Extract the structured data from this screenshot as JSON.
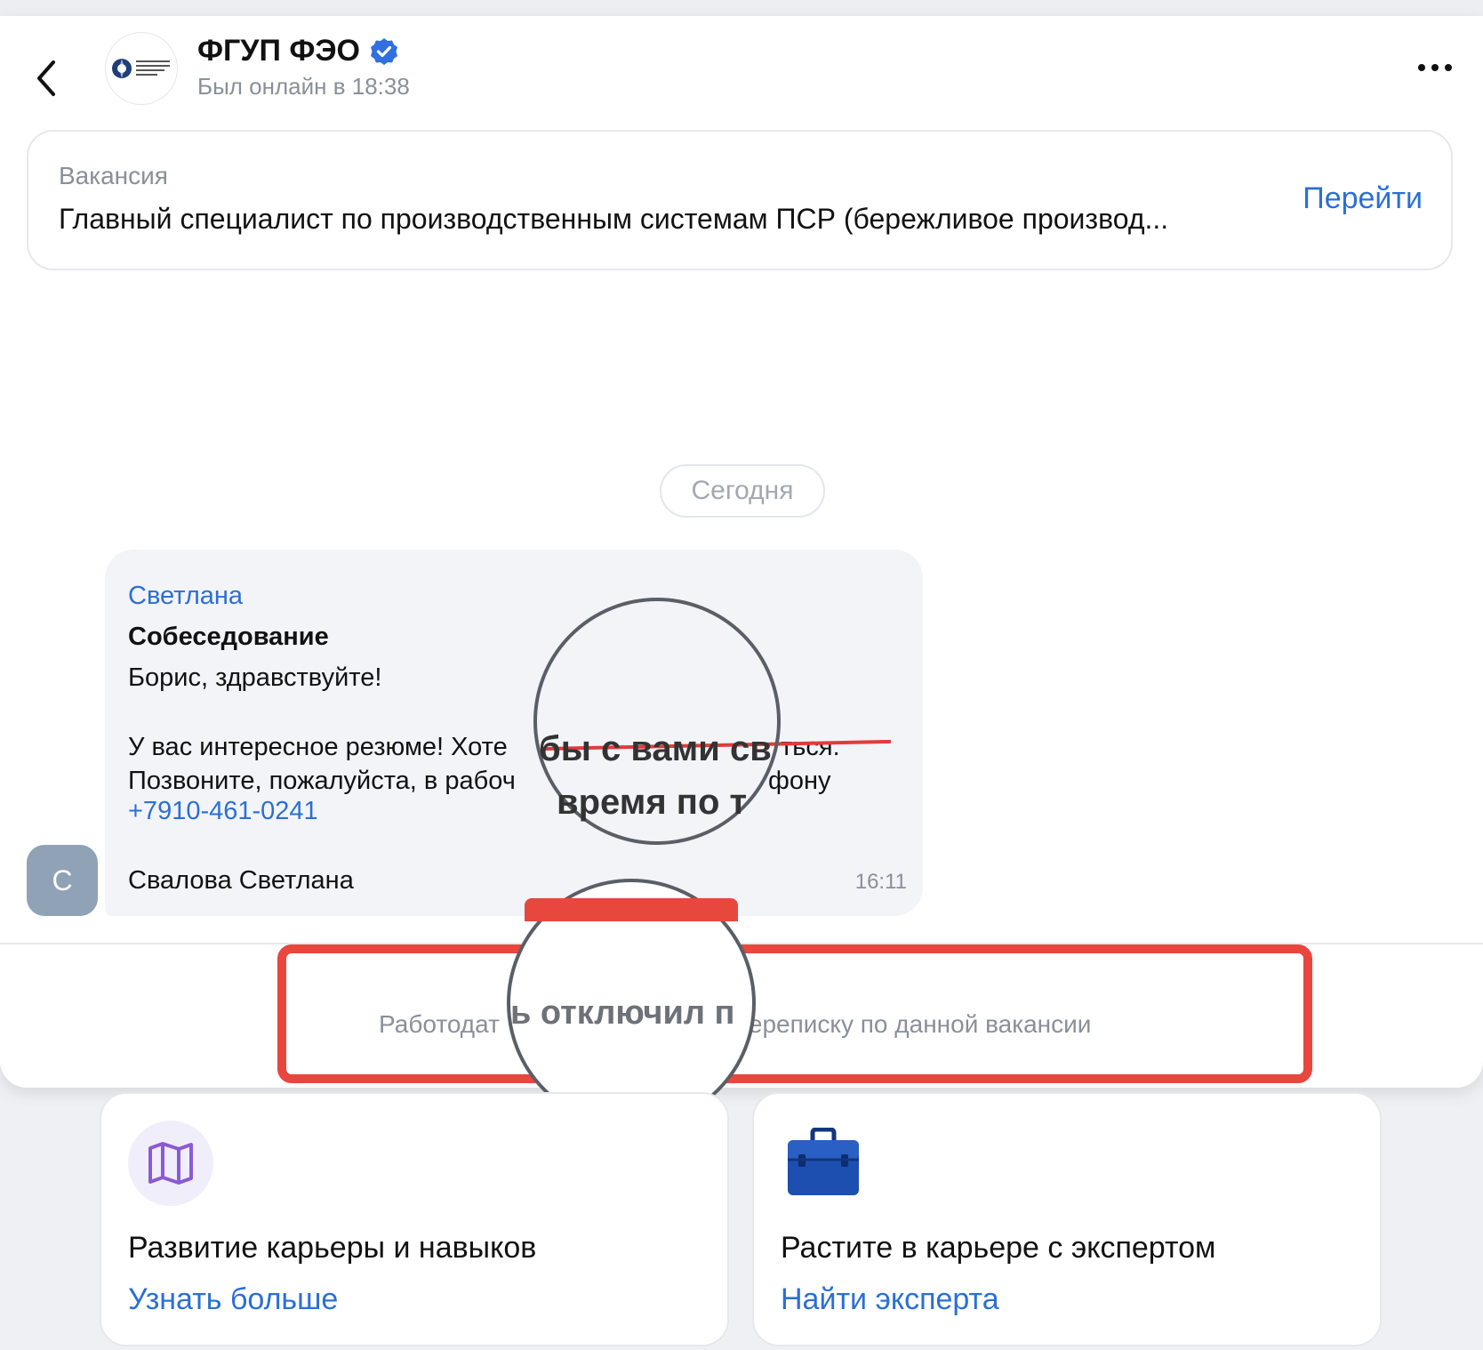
{
  "header": {
    "company_name": "ФГУП ФЭО",
    "status": "Был онлайн в 18:38"
  },
  "vacancy": {
    "label": "Вакансия",
    "title": "Главный специалист по производственным системам ПСР (бережливое производ...",
    "go_label": "Перейти"
  },
  "chat": {
    "date_label": "Сегодня",
    "message": {
      "sender": "Светлана",
      "subject": "Собеседование",
      "greeting": "Борис, здравствуйте!",
      "line1": "У вас интересное резюме! Хоте",
      "line1_end": "ться.",
      "line2": "Позвоните, пожалуйста, в рабоч",
      "line2_end": "фону",
      "phone": "+7910-461-0241",
      "signature": "Свалова Светлана",
      "time": "16:11"
    },
    "avatar_letter": "С",
    "magnifier1_line1": "бы с вами св",
    "magnifier1_line2": "время по т",
    "notice_left": "Работодат",
    "notice_magnified": "ь отключил п",
    "notice_right": "ереписку по данной вакансии"
  },
  "promos": [
    {
      "title": "Развитие карьеры и навыков",
      "link": "Узнать больше",
      "icon": "map-icon"
    },
    {
      "title": "Растите в карьере с экспертом",
      "link": "Найти эксперта",
      "icon": "briefcase-icon"
    }
  ],
  "colors": {
    "accent": "#2b6fd6",
    "highlight": "#e8473e",
    "verified": "#2f6fe0"
  }
}
